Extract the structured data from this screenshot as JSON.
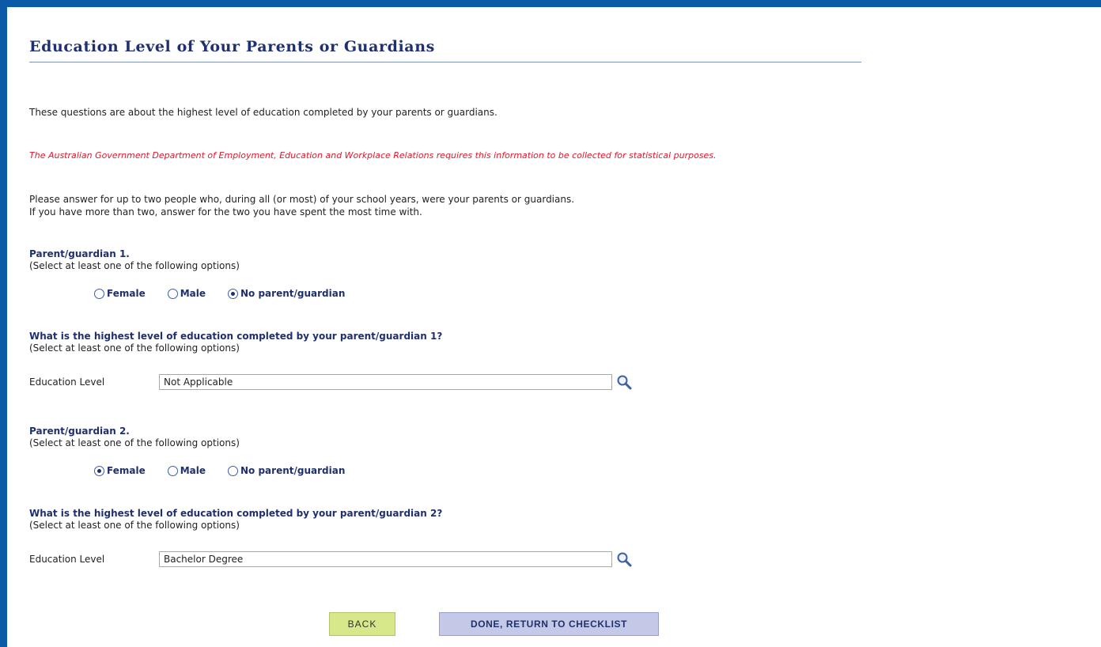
{
  "page": {
    "title": "Education Level of Your Parents or Guardians",
    "intro": "These questions are about the highest level of education completed by your parents or guardians.",
    "notice": "The Australian Government Department of Employment, Education and Workplace Relations requires this information to be collected for statistical purposes.",
    "instructions_line1": "Please answer for up to two people who, during all (or most) of your school years, were your parents or guardians.",
    "instructions_line2": "If you have more than two, answer for the two you have spent the most time with."
  },
  "parent1": {
    "title": "Parent/guardian 1.",
    "hint": "(Select at least one of the following options)",
    "options": [
      "Female",
      "Male",
      "No parent/guardian"
    ],
    "selected": "No parent/guardian",
    "education_question": "What is the highest level of education completed by your parent/guardian 1?",
    "education_hint": "(Select at least one of the following options)",
    "education_label": "Education Level",
    "education_value": "Not Applicable"
  },
  "parent2": {
    "title": "Parent/guardian 2.",
    "hint": "(Select at least one of the following options)",
    "options": [
      "Female",
      "Male",
      "No parent/guardian"
    ],
    "selected": "Female",
    "education_question": "What is the highest level of education completed by your parent/guardian 2?",
    "education_hint": "(Select at least one of the following options)",
    "education_label": "Education Level",
    "education_value": "Bachelor Degree"
  },
  "buttons": {
    "back": "BACK",
    "done": "DONE, RETURN TO CHECKLIST"
  },
  "colors": {
    "frame": "#0a5aa8",
    "heading": "#20306e",
    "notice": "#e8152a",
    "back_button": "#d6e88a",
    "done_button": "#c3c9e6"
  },
  "icons": {
    "lookup": "magnifier-icon"
  }
}
